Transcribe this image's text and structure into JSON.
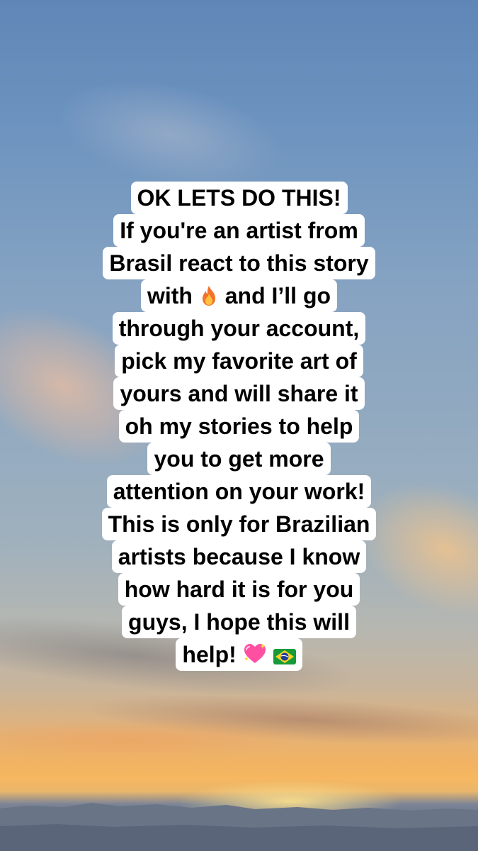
{
  "caption": {
    "lines": [
      "OK LETS DO THIS!",
      "If you're an artist from",
      "Brasil react to this story",
      {
        "before": "with",
        "after": "and I’ll go"
      },
      "through your account,",
      "pick my favorite art of",
      "yours and will share it",
      "oh my stories to help",
      "you to get more",
      "attention on your work!",
      "This is only for Brazilian",
      "artists because I know",
      "how hard it is for you",
      "guys, I hope this will",
      {
        "before": "help!",
        "after": ""
      }
    ]
  },
  "icons": {
    "fire": "fire-emoji",
    "heart": "sparkling-heart-emoji",
    "flag": "brazil-flag-emoji"
  },
  "colors": {
    "caption_bg": "#ffffff",
    "caption_text": "#000000",
    "sky_top": "#5f86b6",
    "sunset_band": "#f6b760"
  }
}
